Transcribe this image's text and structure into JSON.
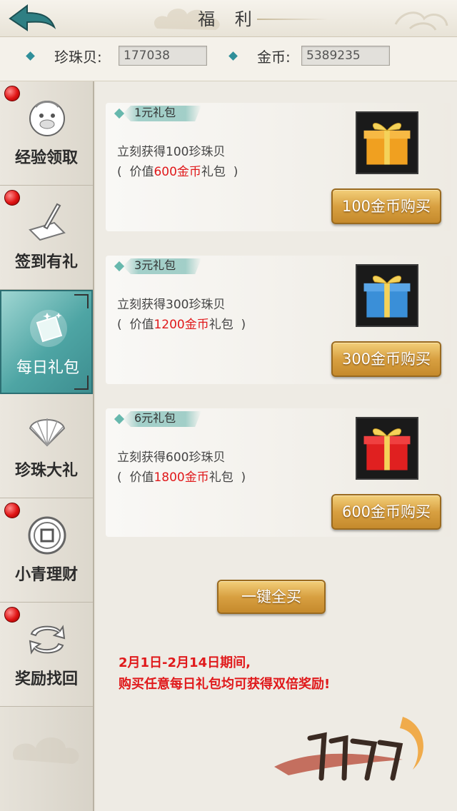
{
  "header": {
    "title": "福 利"
  },
  "currency": {
    "pearl_label": "珍珠贝:",
    "pearl_value": "177038",
    "gold_label": "金币:",
    "gold_value": "5389235"
  },
  "sidebar": {
    "items": [
      {
        "label": "经验领取",
        "icon": "monkey-face-icon",
        "has_dot": true
      },
      {
        "label": "签到有礼",
        "icon": "quill-scroll-icon",
        "has_dot": true
      },
      {
        "label": "每日礼包",
        "icon": "gift-card-icon",
        "has_dot": false
      },
      {
        "label": "珍珠大礼",
        "icon": "shell-icon",
        "has_dot": false
      },
      {
        "label": "小青理财",
        "icon": "coin-icon",
        "has_dot": true
      },
      {
        "label": "奖励找回",
        "icon": "cycle-arrows-icon",
        "has_dot": true
      }
    ]
  },
  "packages": [
    {
      "title": "1元礼包",
      "desc": "立刻获得100珍珠贝",
      "value_prefix": "(  价值",
      "value_amount": "600金币",
      "value_suffix": "礼包  )",
      "button": "100金币购买",
      "box_color": "#f0a020"
    },
    {
      "title": "3元礼包",
      "desc": "立刻获得300珍珠贝",
      "value_prefix": "(  价值",
      "value_amount": "1200金币",
      "value_suffix": "礼包  )",
      "button": "300金币购买",
      "box_color": "#3a8fd8"
    },
    {
      "title": "6元礼包",
      "desc": "立刻获得600珍珠贝",
      "value_prefix": "(  价值",
      "value_amount": "1800金币",
      "value_suffix": "礼包  )",
      "button": "600金币购买",
      "box_color": "#e02020"
    }
  ],
  "buy_all_label": "一键全买",
  "notice": {
    "line1": "2月1日-2月14日期间,",
    "line2": "购买任意每日礼包均可获得双倍奖励!"
  },
  "colors": {
    "accent_teal": "#4ea5a4",
    "gold_button": "#d8a041",
    "red_text": "#e0191b"
  }
}
